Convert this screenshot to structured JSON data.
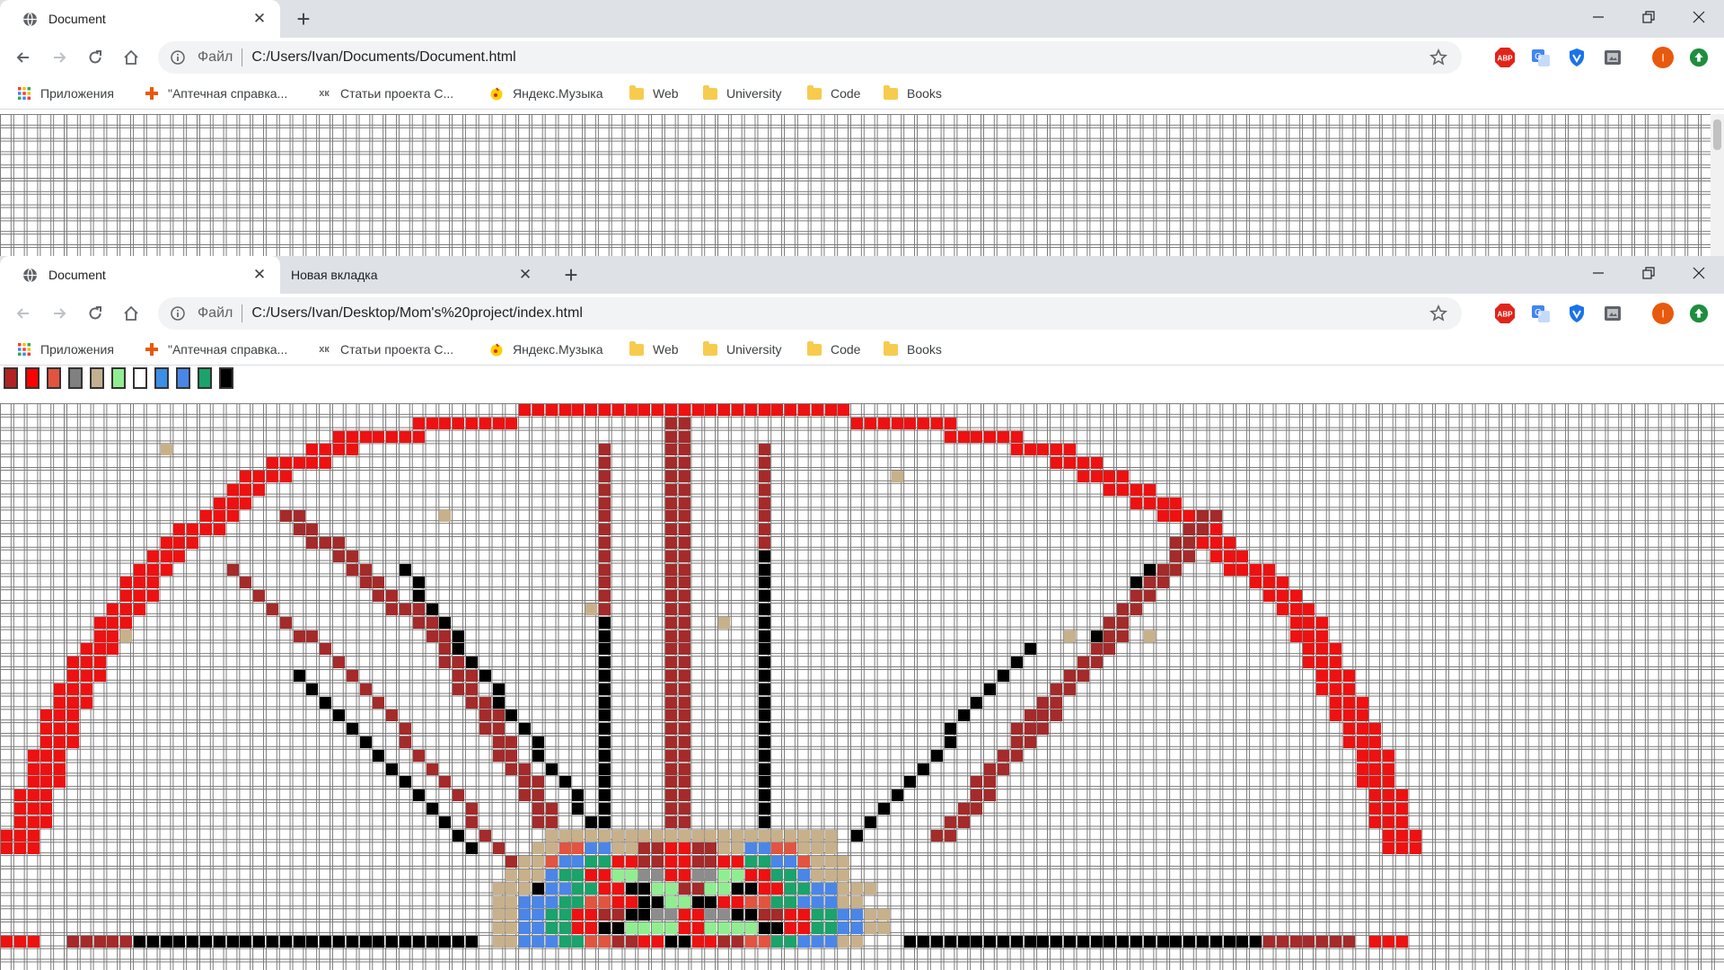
{
  "window1": {
    "tabs": [
      {
        "title": "Document",
        "active": true
      }
    ],
    "new_tab": "+",
    "address": {
      "scheme": "Файл",
      "url": "C:/Users/Ivan/Documents/Document.html"
    },
    "avatar_letter": "I"
  },
  "window2": {
    "tabs": [
      {
        "title": "Document",
        "active": true
      },
      {
        "title": "Новая вкладка",
        "active": false
      }
    ],
    "new_tab": "+",
    "address": {
      "scheme": "Файл",
      "url": "C:/Users/Ivan/Desktop/Mom's%20project/index.html"
    },
    "avatar_letter": "I"
  },
  "bookmarks": [
    {
      "label": "Приложения",
      "icon": "apps-grid-icon"
    },
    {
      "label": "\"Аптечная справка...",
      "icon": "pharmacy-icon"
    },
    {
      "label": "Статьи проекта С...",
      "icon": "xk-icon"
    },
    {
      "label": "Яндекс.Музыка",
      "icon": "yandex-music-icon"
    },
    {
      "label": "Web",
      "icon": "folder-icon"
    },
    {
      "label": "University",
      "icon": "folder-icon"
    },
    {
      "label": "Code",
      "icon": "folder-icon"
    },
    {
      "label": "Books",
      "icon": "folder-icon"
    }
  ],
  "extensions": [
    {
      "name": "adblock-plus-icon",
      "label": "ABP",
      "color": "#e2231a"
    },
    {
      "name": "google-translate-icon",
      "color": "#4285f4"
    },
    {
      "name": "shield-vpn-icon",
      "color": "#1a73e8"
    },
    {
      "name": "screenshot-extension-icon",
      "color": "#5f6368"
    },
    {
      "name": "avatar-icon",
      "color": "#e8590c"
    },
    {
      "name": "update-arrow-icon",
      "color": "#1e8e3e"
    }
  ],
  "palette": [
    "#b22222",
    "#ff0000",
    "#e2543f",
    "#808080",
    "#c3b091",
    "#90ee90",
    "#ffffff",
    "#3a8fe6",
    "#4a86e8",
    "#1aa36b",
    "#000000"
  ],
  "pattern_colors": {
    "R": "#ee1111",
    "D": "#a52a2a",
    "K": "#000000",
    "T": "#c8b08a",
    "B": "#4a86e8",
    "G": "#1aa36b",
    "L": "#90ee90",
    "O": "#e2543f",
    "Y": "#8c8c8c"
  }
}
